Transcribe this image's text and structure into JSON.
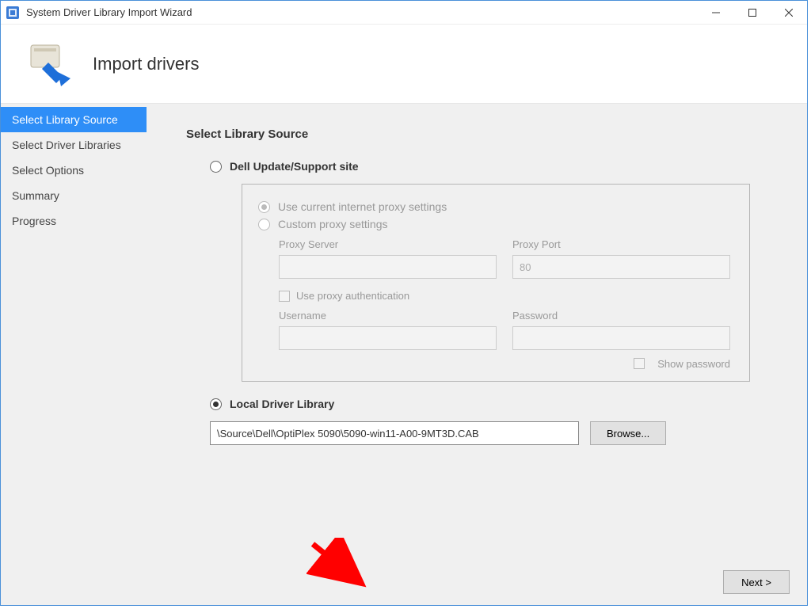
{
  "window": {
    "title": "System Driver Library Import Wizard"
  },
  "header": {
    "title": "Import drivers"
  },
  "sidebar": {
    "items": [
      {
        "label": "Select Library Source",
        "active": true
      },
      {
        "label": "Select Driver Libraries",
        "active": false
      },
      {
        "label": "Select Options",
        "active": false
      },
      {
        "label": "Summary",
        "active": false
      },
      {
        "label": "Progress",
        "active": false
      }
    ]
  },
  "content_title": "Select Library Source",
  "source_options": {
    "dell": "Dell Update/Support site",
    "local": "Local Driver Library"
  },
  "proxy": {
    "use_current": "Use current internet proxy settings",
    "custom": "Custom proxy settings",
    "server_label": "Proxy Server",
    "server_value": "",
    "port_label": "Proxy Port",
    "port_value": "80",
    "auth_label": "Use proxy authentication",
    "user_label": "Username",
    "user_value": "",
    "pass_label": "Password",
    "pass_value": "",
    "show_pw": "Show password"
  },
  "local": {
    "path": "\\Source\\Dell\\OptiPlex 5090\\5090-win11-A00-9MT3D.CAB",
    "browse": "Browse..."
  },
  "footer": {
    "next": "Next >"
  }
}
